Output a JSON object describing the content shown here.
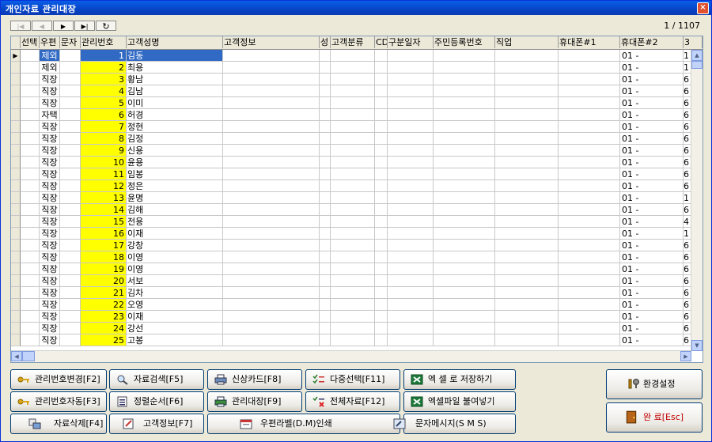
{
  "window": {
    "title": "개인자료 관리대장",
    "close": "×"
  },
  "nav": {
    "first": "|◀",
    "prev": "◀",
    "next": "▶",
    "last": "▶|",
    "refresh": "↻"
  },
  "record_count": "1 / 1107",
  "columns": [
    "선택",
    "우편",
    "문자",
    "관리번호",
    "고객성명",
    "고객정보",
    "성",
    "고객분류",
    "CD",
    "구분일자",
    "주민등록번호",
    "직업",
    "휴대폰#1",
    "휴대폰#2",
    "3"
  ],
  "rows": [
    {
      "zip": "제외",
      "no": "1",
      "name": "김동",
      "ph2": "01 -",
      "x": "1"
    },
    {
      "zip": "제외",
      "no": "2",
      "name": "최용",
      "ph2": "01 -",
      "x": "1"
    },
    {
      "zip": "직장",
      "no": "3",
      "name": "황남",
      "ph2": "01 -",
      "x": "6"
    },
    {
      "zip": "직장",
      "no": "4",
      "name": "김남",
      "ph2": "01 -",
      "x": "6"
    },
    {
      "zip": "직장",
      "no": "5",
      "name": "이미",
      "ph2": "01 -",
      "x": "6"
    },
    {
      "zip": "자택",
      "no": "6",
      "name": "허경",
      "ph2": "01 -",
      "x": "6"
    },
    {
      "zip": "직장",
      "no": "7",
      "name": "정현",
      "ph2": "01 -",
      "x": "6"
    },
    {
      "zip": "직장",
      "no": "8",
      "name": "김정",
      "ph2": "01 -",
      "x": "6"
    },
    {
      "zip": "직장",
      "no": "9",
      "name": "신용",
      "ph2": "01 -",
      "x": "6"
    },
    {
      "zip": "직장",
      "no": "10",
      "name": "윤용",
      "ph2": "01 -",
      "x": "6"
    },
    {
      "zip": "직장",
      "no": "11",
      "name": "임봉",
      "ph2": "01 -",
      "x": "6"
    },
    {
      "zip": "직장",
      "no": "12",
      "name": "정은",
      "ph2": "01 -",
      "x": "6"
    },
    {
      "zip": "직장",
      "no": "13",
      "name": "윤명",
      "ph2": "01 -",
      "x": "1"
    },
    {
      "zip": "직장",
      "no": "14",
      "name": "김해",
      "ph2": "01 -",
      "x": "6"
    },
    {
      "zip": "직장",
      "no": "15",
      "name": "전용",
      "ph2": "01 -",
      "x": "4"
    },
    {
      "zip": "직장",
      "no": "16",
      "name": "이재",
      "ph2": "01 -",
      "x": "1"
    },
    {
      "zip": "직장",
      "no": "17",
      "name": "강창",
      "ph2": "01 -",
      "x": "6"
    },
    {
      "zip": "직장",
      "no": "18",
      "name": "이영",
      "ph2": "01 -",
      "x": "6"
    },
    {
      "zip": "직장",
      "no": "19",
      "name": "이영",
      "ph2": "01 -",
      "x": "6"
    },
    {
      "zip": "직장",
      "no": "20",
      "name": "서보",
      "ph2": "01 -",
      "x": "6"
    },
    {
      "zip": "직장",
      "no": "21",
      "name": "김차",
      "ph2": "01 -",
      "x": "6"
    },
    {
      "zip": "직장",
      "no": "22",
      "name": "오영",
      "ph2": "01 -",
      "x": "6"
    },
    {
      "zip": "직장",
      "no": "23",
      "name": "이재",
      "ph2": "01 -",
      "x": "6"
    },
    {
      "zip": "직장",
      "no": "24",
      "name": "강선",
      "ph2": "01 -",
      "x": "6"
    },
    {
      "zip": "직장",
      "no": "25",
      "name": "고봉",
      "ph2": "01 -",
      "x": "6"
    }
  ],
  "buttons": {
    "b1": "관리번호변경[F2]",
    "b2": "자료검색[F5]",
    "b3": "신상카드[F8]",
    "b4": "다중선택[F11]",
    "b5": "엑 셀 로 저장하기",
    "b6": "환경설정",
    "b7": "관리번호자동[F3]",
    "b8": "정렬순서[F6]",
    "b9": "관리대장[F9]",
    "b10": "전체자료[F12]",
    "b11": "엑셀파일 불여넣기",
    "b12": "자료삭제[F4]",
    "b13": "고객정보[F7]",
    "b14": "우편라벨(D.M)인쇄",
    "b15": "문자메시지(S M S)",
    "b16": "완 료[Esc]"
  }
}
